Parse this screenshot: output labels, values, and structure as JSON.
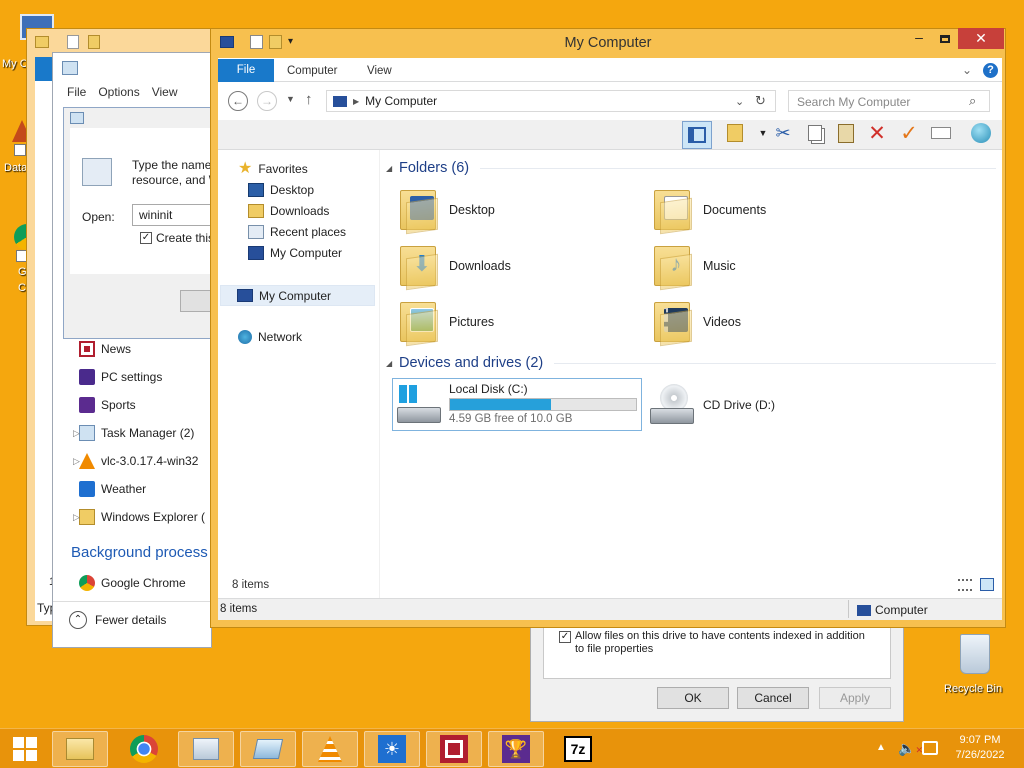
{
  "desktop": {
    "icons": [
      {
        "label": "My C"
      },
      {
        "label": "Data"
      },
      {
        "label": "G"
      },
      {
        "label": "C"
      },
      {
        "label": "Recycle Bin"
      }
    ]
  },
  "run_dialog": {
    "prompt": "Type the name of a program, folder, document, or Internet resource, and Windows will open it for you.",
    "open_label": "Open:",
    "open_value": "wininit",
    "checkbox_label": "Create this task with administrative privileges.",
    "partial_prompt_line1": "Type the name",
    "partial_prompt_line2": "resource, and W",
    "partial_checkbox": "Create this"
  },
  "task_manager": {
    "menu": [
      "File",
      "Options",
      "View"
    ],
    "apps": [
      {
        "label": "News",
        "expandable": false
      },
      {
        "label": "PC settings",
        "expandable": false
      },
      {
        "label": "Sports",
        "expandable": false
      },
      {
        "label": "Task Manager (2)",
        "expandable": true
      },
      {
        "label": "vlc-3.0.17.4-win32",
        "expandable": true
      },
      {
        "label": "Weather",
        "expandable": false
      },
      {
        "label": "Windows Explorer (",
        "expandable": true
      }
    ],
    "section_background": "Background process",
    "bg_apps": [
      {
        "label": "Google Chrome"
      }
    ],
    "fewer_details": "Fewer details",
    "left_stub_1": "1",
    "left_stub_2": "Typ"
  },
  "properties_dialog": {
    "index_checkbox": "Allow files on this drive to have contents indexed in addition to file properties",
    "ok": "OK",
    "cancel": "Cancel",
    "apply": "Apply"
  },
  "explorer": {
    "title": "My Computer",
    "tabs": {
      "file": "File",
      "computer": "Computer",
      "view": "View"
    },
    "address": "My Computer",
    "search_placeholder": "Search My Computer",
    "nav": {
      "favorites": "Favorites",
      "desktop": "Desktop",
      "downloads": "Downloads",
      "recent": "Recent places",
      "mycomputer_fav": "My Computer",
      "mycomputer": "My Computer",
      "network": "Network"
    },
    "folders_title": "Folders (6)",
    "folders": [
      {
        "label": "Desktop"
      },
      {
        "label": "Documents"
      },
      {
        "label": "Downloads"
      },
      {
        "label": "Music"
      },
      {
        "label": "Pictures"
      },
      {
        "label": "Videos"
      }
    ],
    "devices_title": "Devices and drives (2)",
    "drives": [
      {
        "label": "Local Disk (C:)",
        "free": "4.59 GB free of 10.0 GB",
        "used_fraction": 0.541
      },
      {
        "label": "CD Drive (D:)"
      }
    ],
    "items_count_inner": "8 items",
    "status_items": "8 items",
    "status_location": "Computer"
  },
  "taskbar": {
    "time": "9:07 PM",
    "date": "7/26/2022"
  },
  "colors": {
    "desktop": "#f5a70e",
    "frame": "#f7c04f",
    "accent_blue": "#1979ca",
    "disk_bar": "#26a0da"
  }
}
